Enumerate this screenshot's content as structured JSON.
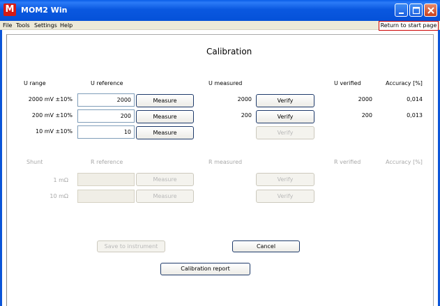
{
  "window": {
    "title": "MOM2 Win",
    "icon": "app-logo-icon"
  },
  "menu": {
    "items": [
      "File",
      "Tools",
      "Settings",
      "Help"
    ],
    "return_label": "Return to start page"
  },
  "page": {
    "title": "Calibration"
  },
  "voltage": {
    "headers": {
      "range": "U range",
      "reference": "U reference",
      "measured": "U measured",
      "verified": "U verified",
      "accuracy": "Accuracy [%]"
    },
    "rows": [
      {
        "range": "2000 mV ±10%",
        "reference": "2000",
        "measure": "Measure",
        "measured": "2000",
        "verify": "Verify",
        "verified": "2000",
        "accuracy": "0,014"
      },
      {
        "range": "200 mV ±10%",
        "reference": "200",
        "measure": "Measure",
        "measured": "200",
        "verify": "Verify",
        "verified": "200",
        "accuracy": "0,013"
      },
      {
        "range": "10 mV ±10%",
        "reference": "10",
        "measure": "Measure",
        "measured": "",
        "verify": "Verify",
        "verified": "",
        "accuracy": ""
      }
    ]
  },
  "shunt": {
    "headers": {
      "range": "Shunt",
      "reference": "R reference",
      "measured": "R measured",
      "verified": "R verified",
      "accuracy": "Accuracy [%]"
    },
    "rows": [
      {
        "range": "1 mΩ",
        "reference": "",
        "measure": "Measure",
        "verify": "Verify"
      },
      {
        "range": "10 mΩ",
        "reference": "",
        "measure": "Measure",
        "verify": "Verify"
      }
    ]
  },
  "actions": {
    "save": "Save to instrument",
    "cancel": "Cancel",
    "report": "Calibration report"
  }
}
